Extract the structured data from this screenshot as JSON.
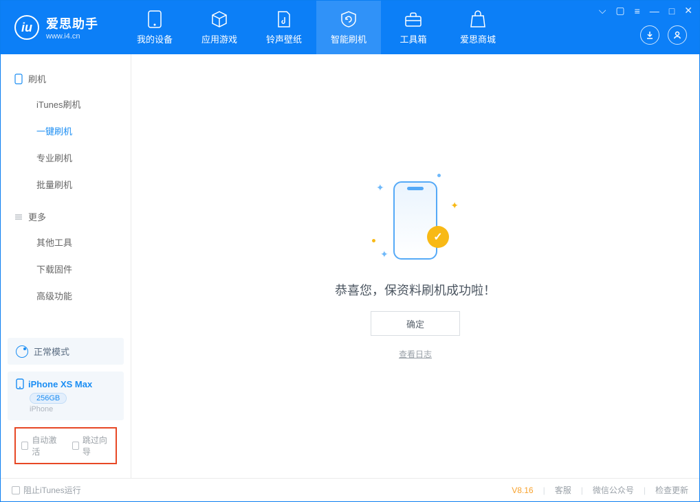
{
  "app": {
    "title": "爱思助手",
    "url": "www.i4.cn"
  },
  "tabs": [
    {
      "label": "我的设备",
      "icon": "device"
    },
    {
      "label": "应用游戏",
      "icon": "cube"
    },
    {
      "label": "铃声壁纸",
      "icon": "music"
    },
    {
      "label": "智能刷机",
      "icon": "refresh",
      "active": true
    },
    {
      "label": "工具箱",
      "icon": "toolbox"
    },
    {
      "label": "爱思商城",
      "icon": "bag"
    }
  ],
  "sidebar": {
    "sections": [
      {
        "title": "刷机",
        "items": [
          {
            "label": "iTunes刷机"
          },
          {
            "label": "一键刷机",
            "selected": true
          },
          {
            "label": "专业刷机"
          },
          {
            "label": "批量刷机"
          }
        ]
      },
      {
        "title": "更多",
        "items": [
          {
            "label": "其他工具"
          },
          {
            "label": "下载固件"
          },
          {
            "label": "高级功能"
          }
        ]
      }
    ],
    "mode": "正常模式",
    "device": {
      "name": "iPhone XS Max",
      "capacity": "256GB",
      "type": "iPhone"
    },
    "checkboxes": {
      "auto_activate": "自动激活",
      "skip_guide": "跳过向导"
    }
  },
  "main": {
    "message": "恭喜您，保资料刷机成功啦！",
    "ok_button": "确定",
    "view_log": "查看日志"
  },
  "footer": {
    "block_itunes": "阻止iTunes运行",
    "version": "V8.16",
    "links": [
      "客服",
      "微信公众号",
      "检查更新"
    ]
  }
}
